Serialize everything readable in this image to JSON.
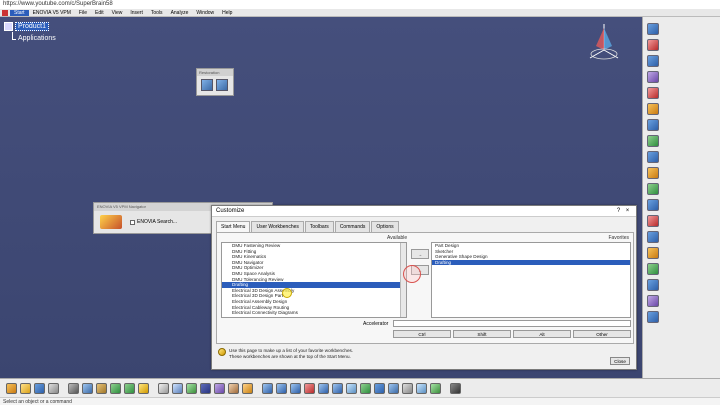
{
  "url": "https://www.youtube.com/c/SuperBrain58",
  "menu": {
    "items": [
      "Start",
      "ENOVIA V5 VPM",
      "File",
      "Edit",
      "View",
      "Insert",
      "Tools",
      "Analyze",
      "Window",
      "Help"
    ],
    "active_index": 0
  },
  "tree": {
    "root": "Product1",
    "child": "Applications"
  },
  "enovia_panel": {
    "title": "ENOVIA V5 VPM Navigator",
    "search_label": "ENOVIA Search..."
  },
  "small_toolbar": {
    "title": "Restoration"
  },
  "dialog": {
    "title": "Customize",
    "close_x": "×",
    "help_mark": "?",
    "tabs": [
      "Start Menu",
      "User Workbenches",
      "Toolbars",
      "Commands",
      "Options"
    ],
    "active_tab": 0,
    "available_header": "Available",
    "favorites_header": "Favorites",
    "available_items": [
      "DMU Fastening Review",
      "DMU Fitting",
      "DMU Kinematics",
      "DMU Navigator",
      "DMU Optimizer",
      "DMU Space Analysis",
      "DMU Tolerancing Review",
      "Drafting",
      "Electrical 3D Design Assembly",
      "Electrical 3D Design Part",
      "Electrical Assembly Design",
      "Electrical Cableway Routing",
      "Electrical Connectivity Diagrams"
    ],
    "available_selected": 7,
    "favorite_items": [
      "Part Design",
      "Sketcher",
      "Generative Shape Design",
      "Drafting"
    ],
    "favorite_selected": 3,
    "move_buttons": [
      "→",
      "←"
    ],
    "accelerator_label": "Accelerator",
    "modifier_buttons": [
      "Ctrl",
      "Shift",
      "Alt",
      "Other"
    ],
    "help_lines": [
      "Use this page to make up a list of your favorite workbenches.",
      "These workbenches are shown at the top of the Start Menu."
    ],
    "close_label": "Close"
  },
  "status": "Select an object or a command",
  "colors": {
    "viewport_bg": "#3f4a74",
    "selection": "#2b5dbb"
  }
}
